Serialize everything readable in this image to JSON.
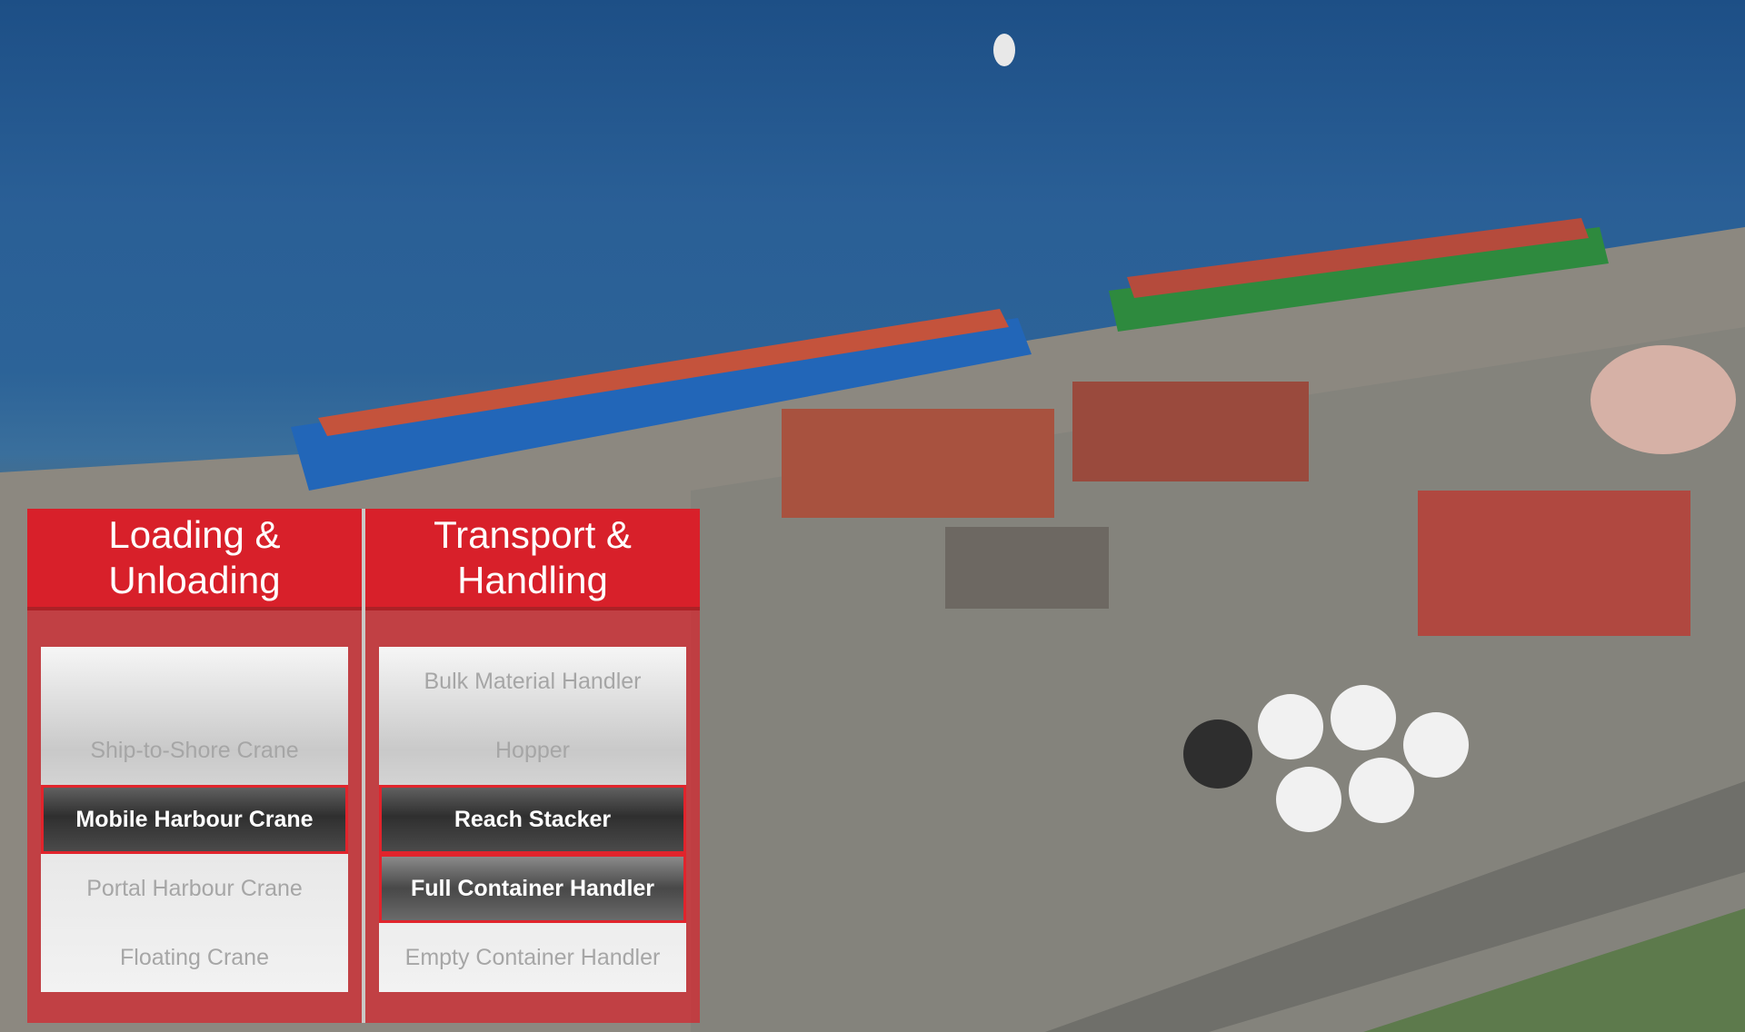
{
  "panel": {
    "loading": {
      "title": "Loading &\nUnloading",
      "items": [
        {
          "label": "",
          "state": "inactive"
        },
        {
          "label": "Ship-to-Shore Crane",
          "state": "inactive"
        },
        {
          "label": "Mobile Harbour Crane",
          "state": "active"
        },
        {
          "label": "Portal Harbour Crane",
          "state": "inactive"
        },
        {
          "label": "Floating Crane",
          "state": "inactive"
        }
      ]
    },
    "transport": {
      "title": "Transport &\nHandling",
      "items": [
        {
          "label": "Bulk Material Handler",
          "state": "inactive"
        },
        {
          "label": "Hopper",
          "state": "inactive"
        },
        {
          "label": "Reach Stacker",
          "state": "active"
        },
        {
          "label": "Full Container Handler",
          "state": "active"
        },
        {
          "label": "Empty Container Handler",
          "state": "inactive"
        }
      ]
    }
  },
  "colors": {
    "accent_red": "#d8202a",
    "active_text": "#ffffff",
    "inactive_text": "#a6a6a6"
  }
}
